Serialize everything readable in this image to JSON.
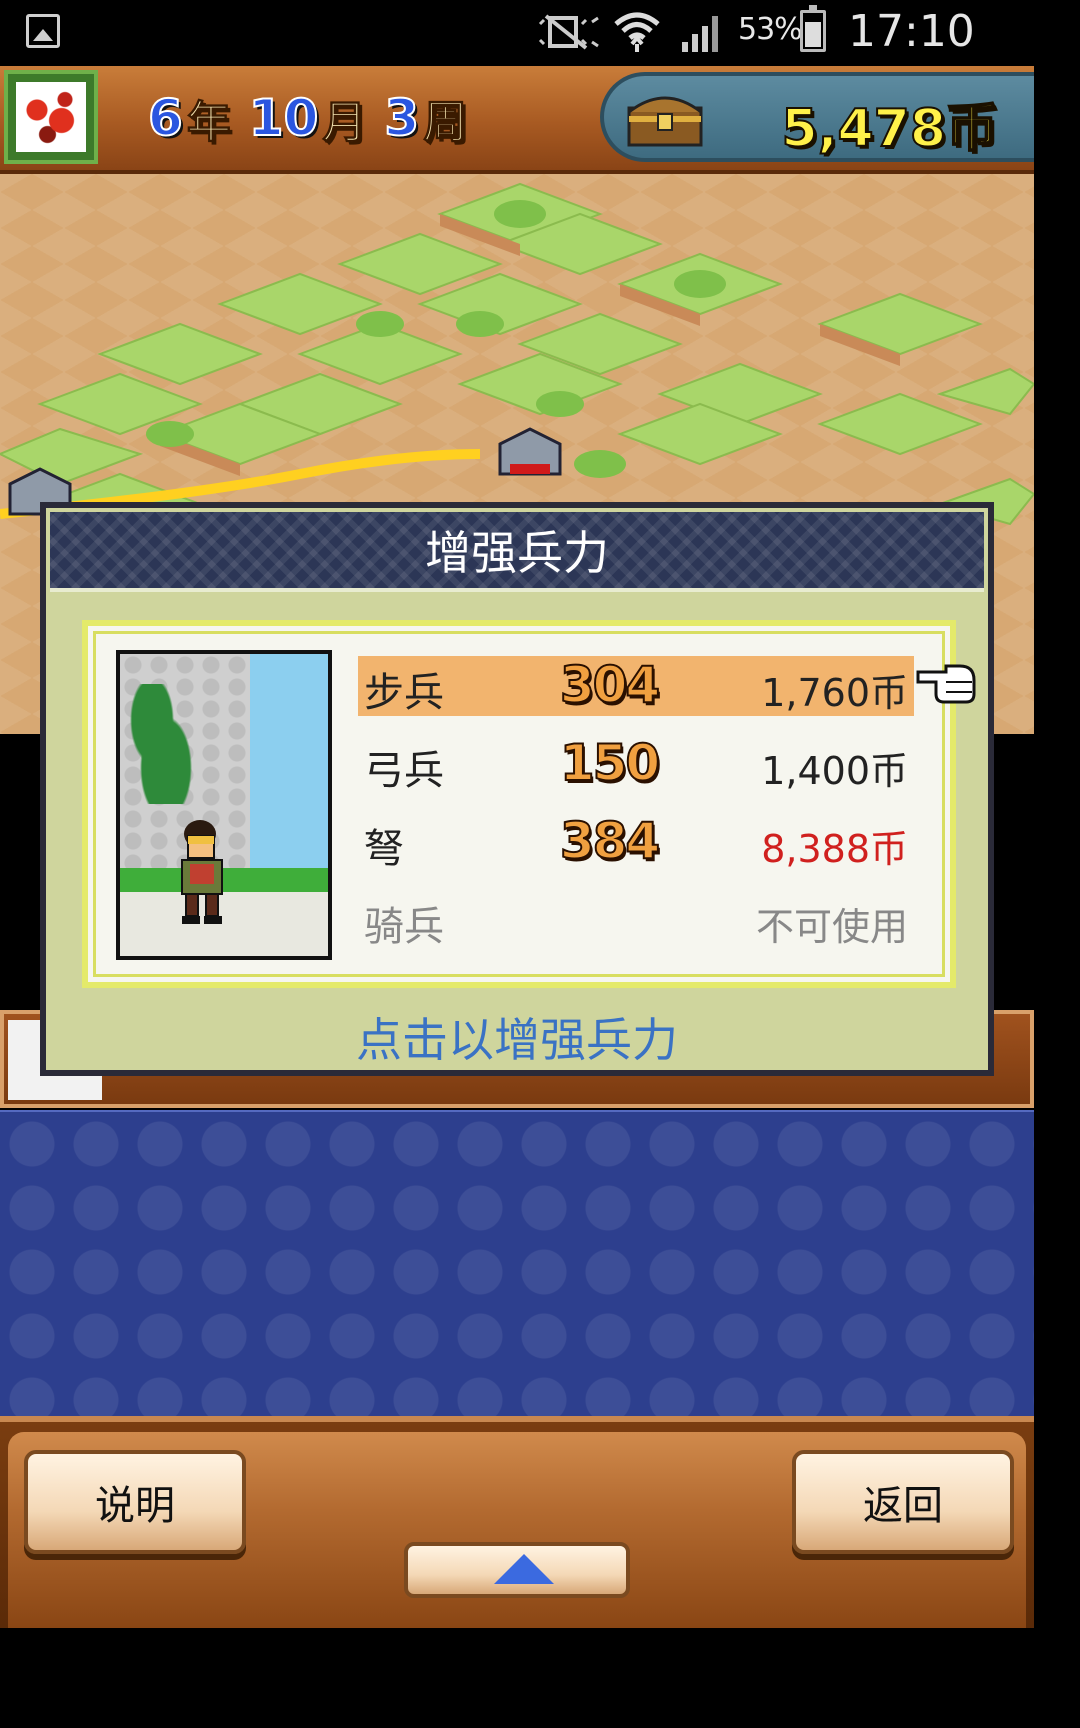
{
  "status_bar": {
    "battery_percent": "53%",
    "time": "17:10",
    "icons": [
      "gallery-icon",
      "mute-vibrate-icon",
      "wifi-icon",
      "signal-icon",
      "battery-icon"
    ]
  },
  "header": {
    "year_num": "6",
    "year_unit": "年",
    "month_num": "10",
    "month_unit": "月",
    "week_num": "3",
    "week_unit": "周",
    "money": "5,478币"
  },
  "dialog": {
    "title": "增强兵力",
    "hint": "点击以增强兵力",
    "troops": [
      {
        "name": "步兵",
        "count": "304",
        "price": "1,760币",
        "selected": true,
        "price_color": "normal"
      },
      {
        "name": "弓兵",
        "count": "150",
        "price": "1,400币",
        "selected": false,
        "price_color": "normal"
      },
      {
        "name": "弩",
        "count": "384",
        "price": "8,388币",
        "selected": false,
        "price_color": "red"
      },
      {
        "name": "骑兵",
        "count": "",
        "price": "不可使用",
        "selected": false,
        "price_color": "disabled"
      }
    ]
  },
  "bottom": {
    "explain_label": "说明",
    "back_label": "返回"
  },
  "colors": {
    "selected_row": "#f2b46e",
    "hint_text": "#3a72c4",
    "insufficient_price": "#d0201e",
    "money_text": "#fff14a"
  }
}
